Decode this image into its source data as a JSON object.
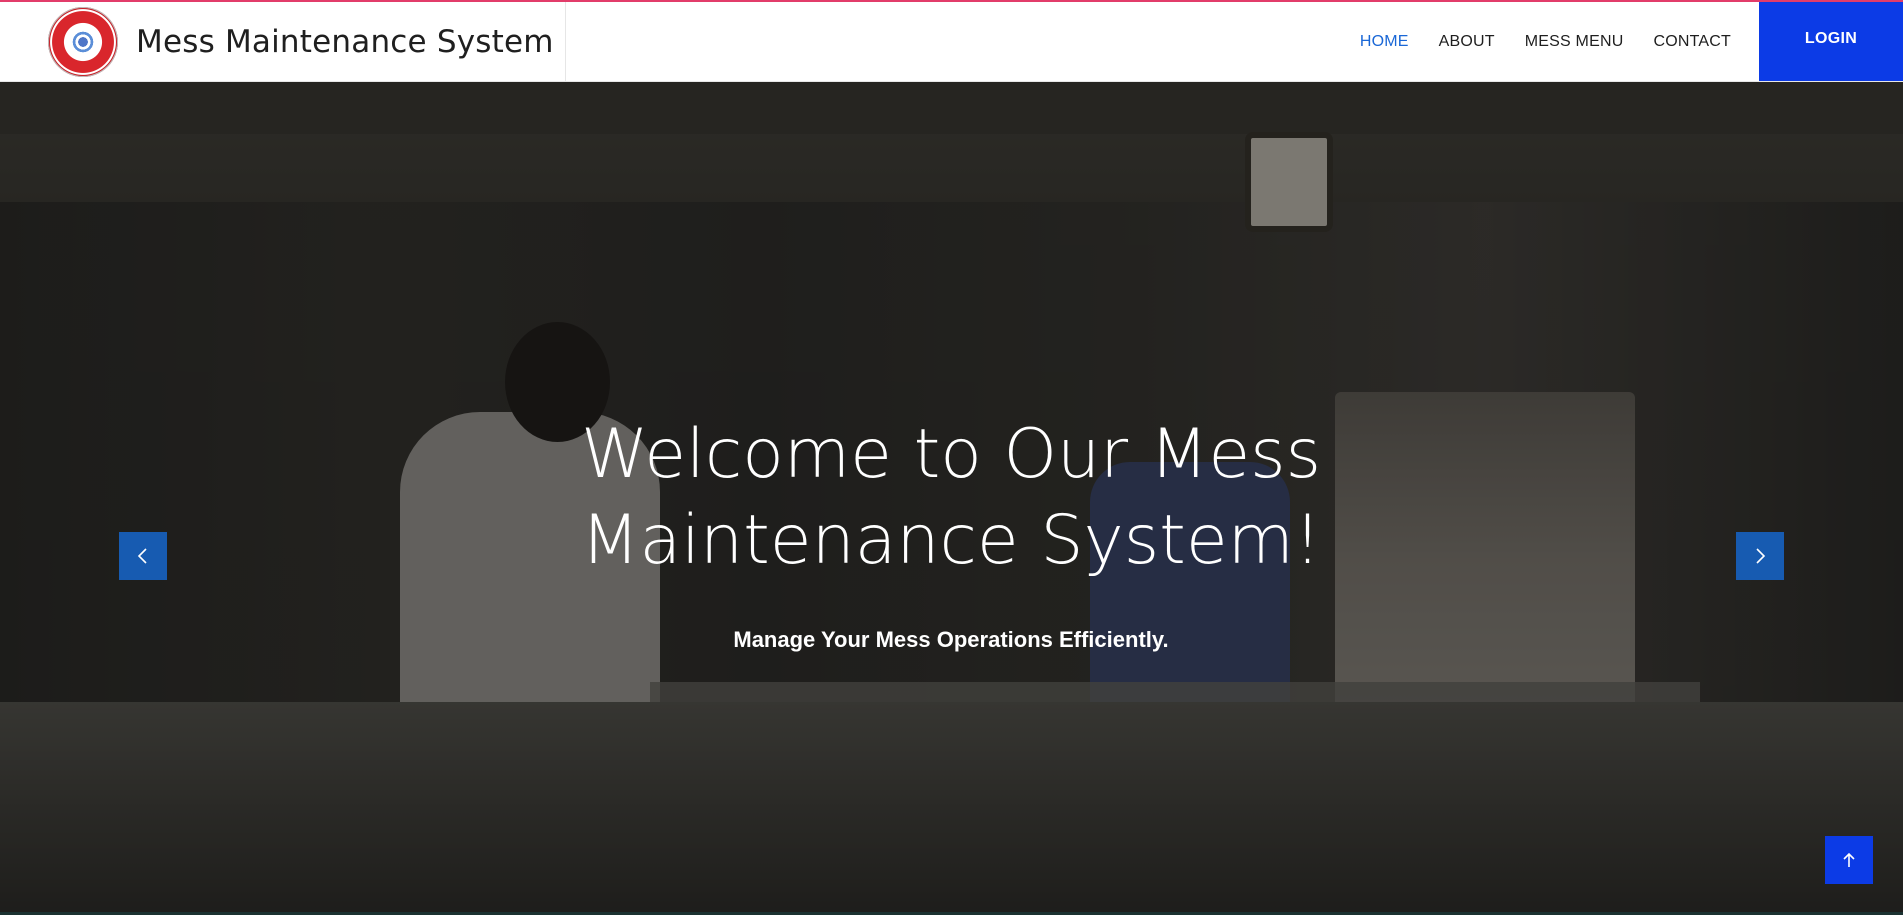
{
  "header": {
    "brand_title": "Mess Maintenance System",
    "nav": [
      {
        "label": "HOME",
        "active": true
      },
      {
        "label": "ABOUT",
        "active": false
      },
      {
        "label": "MESS MENU",
        "active": false
      },
      {
        "label": "CONTACT",
        "active": false
      }
    ],
    "login_label": "LOGIN"
  },
  "hero": {
    "title_line1": "Welcome to Our Mess",
    "title_line2": "Maintenance System!",
    "subtitle": "Manage Your Mess Operations Efficiently."
  },
  "icons": {
    "prev": "chevron-left-icon",
    "next": "chevron-right-icon",
    "back_to_top": "arrow-up-icon"
  },
  "colors": {
    "accent": "#0c3be6",
    "nav_active": "#1a67d6",
    "carousel_button": "#175bb1",
    "top_border": "#e23c6a"
  }
}
